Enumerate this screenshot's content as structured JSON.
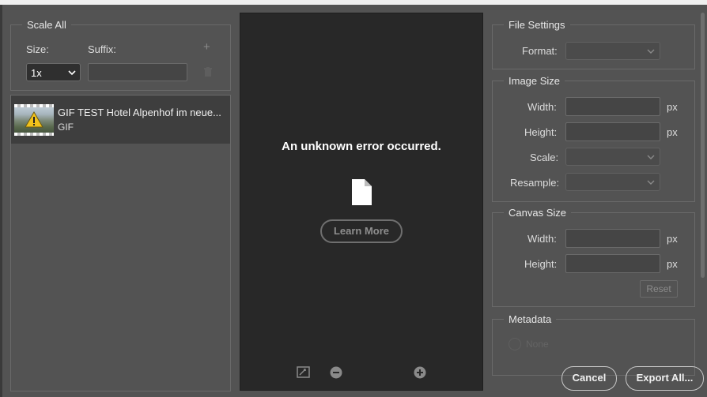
{
  "scale_all": {
    "title": "Scale All",
    "size_label": "Size:",
    "suffix_label": "Suffix:",
    "size_value": "1x",
    "suffix_value": "",
    "add_icon": "plus-icon",
    "delete_icon": "trash-icon"
  },
  "asset": {
    "name": "GIF TEST Hotel Alpenhof im neue...",
    "format": "GIF"
  },
  "preview": {
    "error_message": "An unknown error occurred.",
    "learn_more_label": "Learn More"
  },
  "file_settings": {
    "title": "File Settings",
    "format_label": "Format:",
    "format_value": ""
  },
  "image_size": {
    "title": "Image Size",
    "width_label": "Width:",
    "height_label": "Height:",
    "scale_label": "Scale:",
    "resample_label": "Resample:",
    "width_value": "",
    "height_value": "",
    "unit": "px"
  },
  "canvas_size": {
    "title": "Canvas Size",
    "width_label": "Width:",
    "height_label": "Height:",
    "width_value": "",
    "height_value": "",
    "unit": "px",
    "reset_label": "Reset"
  },
  "metadata": {
    "title": "Metadata",
    "none_label": "None"
  },
  "footer": {
    "cancel_label": "Cancel",
    "export_label": "Export All..."
  },
  "colors": {
    "dialog_bg": "#535353",
    "preview_bg": "#282828",
    "selected_row": "#3e3e3e"
  }
}
